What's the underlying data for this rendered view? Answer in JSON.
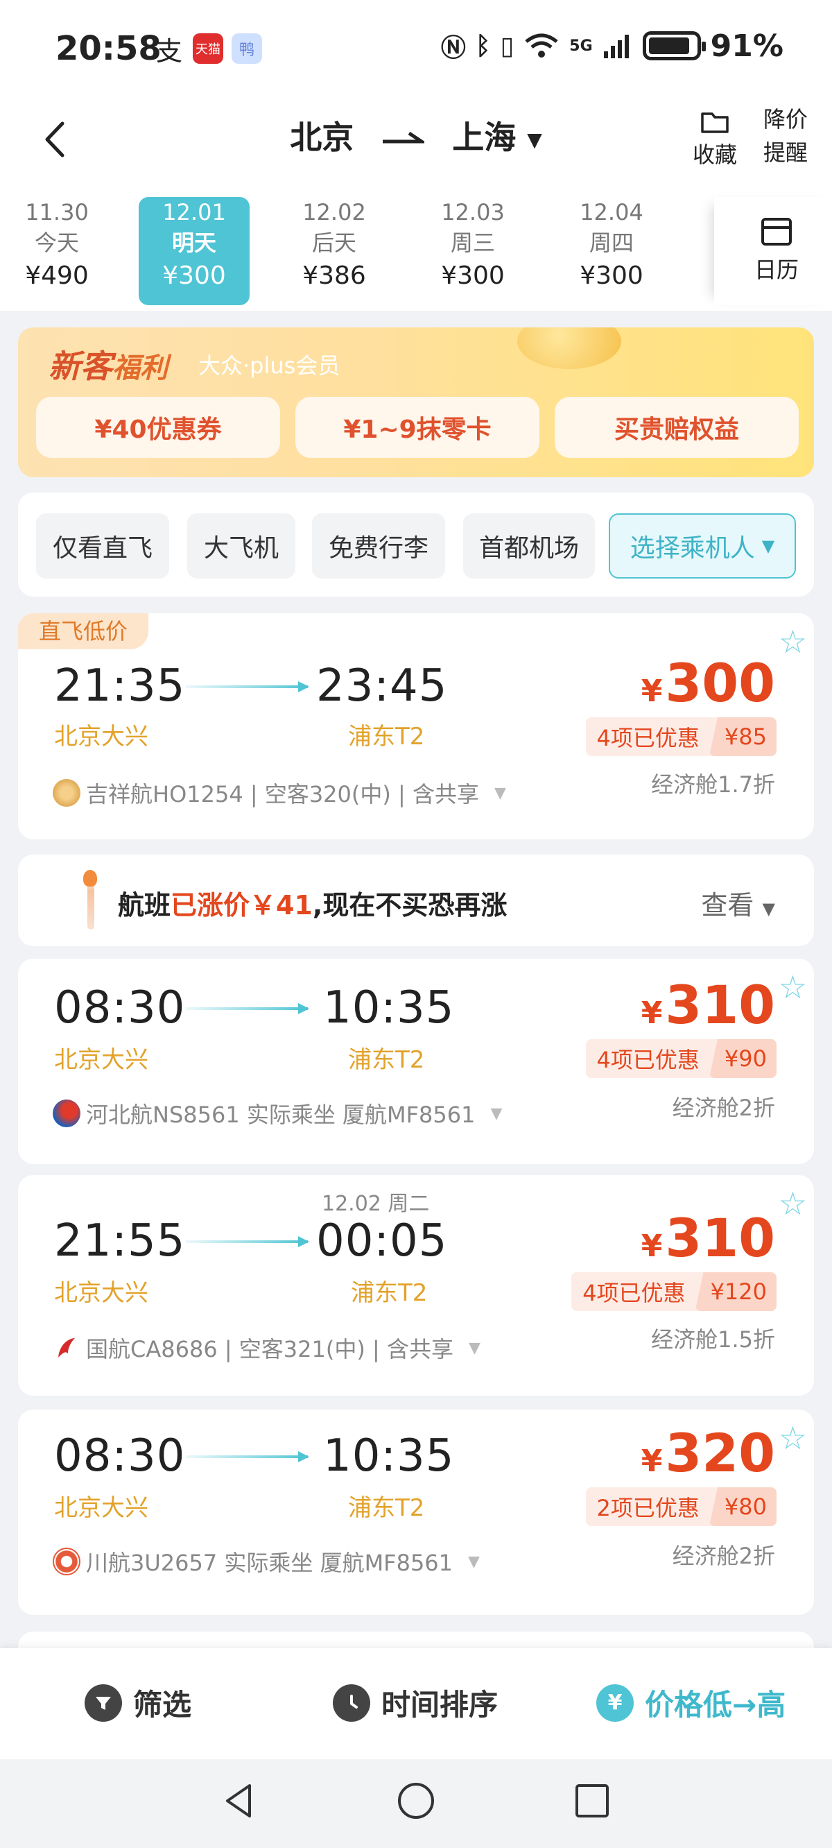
{
  "status_bar": {
    "time": "20:58",
    "apps": [
      "支",
      "天猫",
      "鸭"
    ],
    "network": "5G",
    "battery": "91%",
    "icons": [
      "nfc-icon",
      "bluetooth-icon",
      "vibrate-icon",
      "wifi-icon",
      "signal-icon",
      "battery-icon"
    ]
  },
  "header": {
    "from": "北京",
    "to": "上海",
    "favorite_label": "收藏",
    "price_alert_label_1": "降价",
    "price_alert_label_2": "提醒"
  },
  "dates": [
    {
      "date": "11.30",
      "weekday": "今天",
      "price": "¥490",
      "active": false
    },
    {
      "date": "12.01",
      "weekday": "明天",
      "price": "¥300",
      "active": true
    },
    {
      "date": "12.02",
      "weekday": "后天",
      "price": "¥386",
      "active": false
    },
    {
      "date": "12.03",
      "weekday": "周三",
      "price": "¥300",
      "active": false
    },
    {
      "date": "12.04",
      "weekday": "周四",
      "price": "¥300",
      "active": false
    }
  ],
  "calendar_label": "日历",
  "promo": {
    "title_1": "新客",
    "title_2": "福利",
    "subtitle": "大众·plus会员",
    "buttons": [
      "¥40优惠券",
      "¥1~9抹零卡",
      "买贵赔权益"
    ]
  },
  "filters": {
    "chips": [
      "仅看直飞",
      "大飞机",
      "免费行李",
      "首都机场"
    ],
    "passenger": "选择乘机人"
  },
  "notice": {
    "prefix": "航班",
    "highlight": "已涨价￥41",
    "suffix": ",现在不买恐再涨",
    "link": "查看"
  },
  "flights": [
    {
      "tag": "直飞低价",
      "dep_time": "21:35",
      "dep_airport": "北京大兴",
      "arr_time": "23:45",
      "arr_airport": "浦东T2",
      "next_day": "",
      "price_symbol": "¥",
      "price": "300",
      "discount_count": "4项已优惠",
      "discount_amount": "¥85",
      "cabin": "经济舱1.7折",
      "airline": "吉祥航HO1254 | 空客320(中) | 含共享"
    },
    {
      "tag": "",
      "dep_time": "08:30",
      "dep_airport": "北京大兴",
      "arr_time": "10:35",
      "arr_airport": "浦东T2",
      "next_day": "",
      "price_symbol": "¥",
      "price": "310",
      "discount_count": "4项已优惠",
      "discount_amount": "¥90",
      "cabin": "经济舱2折",
      "airline": "河北航NS8561 实际乘坐 厦航MF8561"
    },
    {
      "tag": "",
      "dep_time": "21:55",
      "dep_airport": "北京大兴",
      "arr_time": "00:05",
      "arr_airport": "浦东T2",
      "next_day": "12.02 周二",
      "price_symbol": "¥",
      "price": "310",
      "discount_count": "4项已优惠",
      "discount_amount": "¥120",
      "cabin": "经济舱1.5折",
      "airline": "国航CA8686 | 空客321(中) | 含共享"
    },
    {
      "tag": "",
      "dep_time": "08:30",
      "dep_airport": "北京大兴",
      "arr_time": "10:35",
      "arr_airport": "浦东T2",
      "next_day": "",
      "price_symbol": "¥",
      "price": "320",
      "discount_count": "2项已优惠",
      "discount_amount": "¥80",
      "cabin": "经济舱2折",
      "airline": "川航3U2657 实际乘坐 厦航MF8561"
    }
  ],
  "bottom_bar": {
    "filter": "筛选",
    "time_sort": "时间排序",
    "price_sort": "价格低→高"
  },
  "colors": {
    "accent": "#4fc4d4",
    "price_red": "#e4471d",
    "airport_orange": "#e3a22a"
  }
}
